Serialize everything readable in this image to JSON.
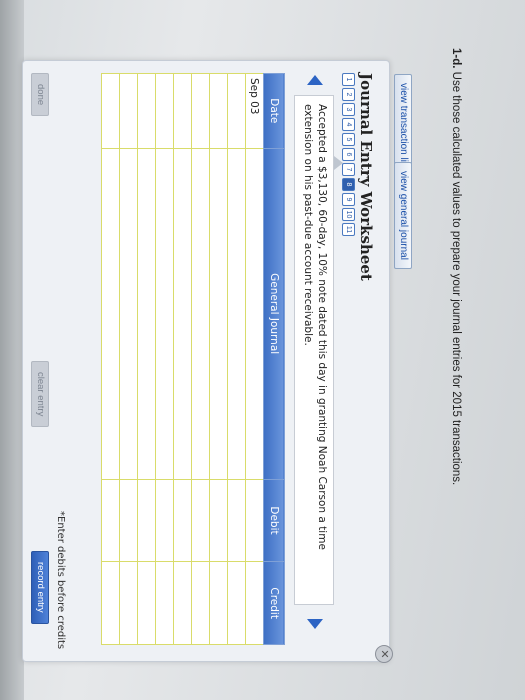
{
  "prompt": {
    "label": "1-d.",
    "text": "Use those calculated values to prepare your journal entries for 2015 transactions."
  },
  "tabs": {
    "transaction_list": "view transaction list",
    "general_journal": "view general journal"
  },
  "worksheet": {
    "title": "Journal Entry Worksheet",
    "steps": [
      "1",
      "2",
      "3",
      "4",
      "5",
      "6",
      "7",
      "8",
      "9",
      "10",
      "11"
    ],
    "active_step": "8",
    "description": "Accepted a $3,130, 60-day, 10% note dated this day in granting Noah Carson a time extension on his past-due account receivable."
  },
  "table": {
    "headers": {
      "date": "Date",
      "general_journal": "General Journal",
      "debit": "Debit",
      "credit": "Credit"
    },
    "first_date": "Sep 03",
    "row_count": 9
  },
  "hint": "*Enter debits before credits",
  "buttons": {
    "done": "done",
    "clear": "clear entry",
    "record": "record entry"
  },
  "icons": {
    "close": "close-icon",
    "prev": "arrow-left-icon",
    "next": "arrow-right-icon"
  },
  "colors": {
    "accent": "#2c64c4",
    "header": "#3d6fc4",
    "grid": "#d9dc6a"
  }
}
